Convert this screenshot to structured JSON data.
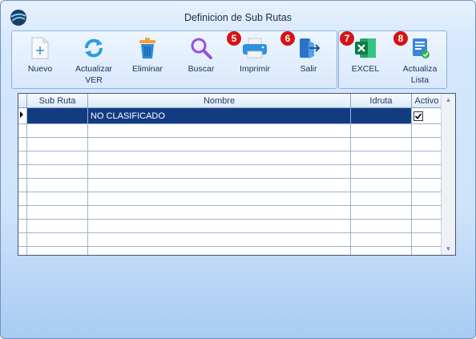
{
  "window": {
    "title": "Definicion de Sub Rutas"
  },
  "toolbar": {
    "buttons": [
      {
        "id": "nuevo",
        "label": "Nuevo",
        "icon": "add-document-icon"
      },
      {
        "id": "actualizar",
        "label": "Actualizar\nVER",
        "icon": "refresh-icon"
      },
      {
        "id": "eliminar",
        "label": "Eliminar",
        "icon": "trash-icon"
      },
      {
        "id": "buscar",
        "label": "Buscar",
        "icon": "search-icon"
      },
      {
        "id": "imprimir",
        "label": "Imprimir",
        "icon": "printer-icon",
        "badge": "5"
      },
      {
        "id": "salir",
        "label": "Salir",
        "icon": "exit-icon",
        "badge": "6"
      }
    ],
    "extra_buttons": [
      {
        "id": "excel",
        "label": "EXCEL",
        "icon": "excel-icon",
        "badge": "7"
      },
      {
        "id": "actualiza_lista",
        "label": "Actualiza\nLista",
        "icon": "list-check-icon",
        "badge": "8"
      }
    ]
  },
  "grid": {
    "columns": [
      "Sub Ruta",
      "Nombre",
      "Idruta",
      "Activo"
    ],
    "rows": [
      {
        "sub_ruta": "",
        "nombre": "NO CLASIFICADO",
        "idruta": "",
        "activo": true,
        "selected": true
      }
    ],
    "empty_rows": 10
  },
  "colors": {
    "selection": "#123b82",
    "badge": "#d51414",
    "accent": "#3b7de0"
  }
}
